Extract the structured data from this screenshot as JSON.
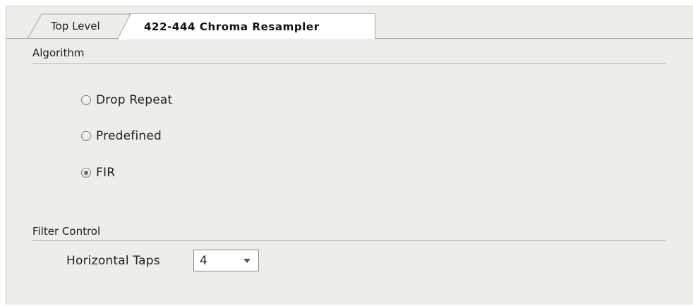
{
  "tabs": [
    {
      "label": "Top Level",
      "active": false
    },
    {
      "label": "422-444 Chroma Resampler",
      "active": true
    }
  ],
  "algorithm": {
    "title": "Algorithm",
    "options": [
      {
        "label": "Drop Repeat",
        "selected": false
      },
      {
        "label": "Predefined",
        "selected": false
      },
      {
        "label": "FIR",
        "selected": true
      }
    ]
  },
  "filter_control": {
    "title": "Filter Control",
    "horizontal_taps": {
      "label": "Horizontal Taps",
      "value": "4",
      "icon": "chevron-down-icon"
    }
  },
  "colors": {
    "panel_bg": "#eeedea",
    "active_tab_bg": "#ffffff",
    "rule": "#b6b5b1"
  }
}
